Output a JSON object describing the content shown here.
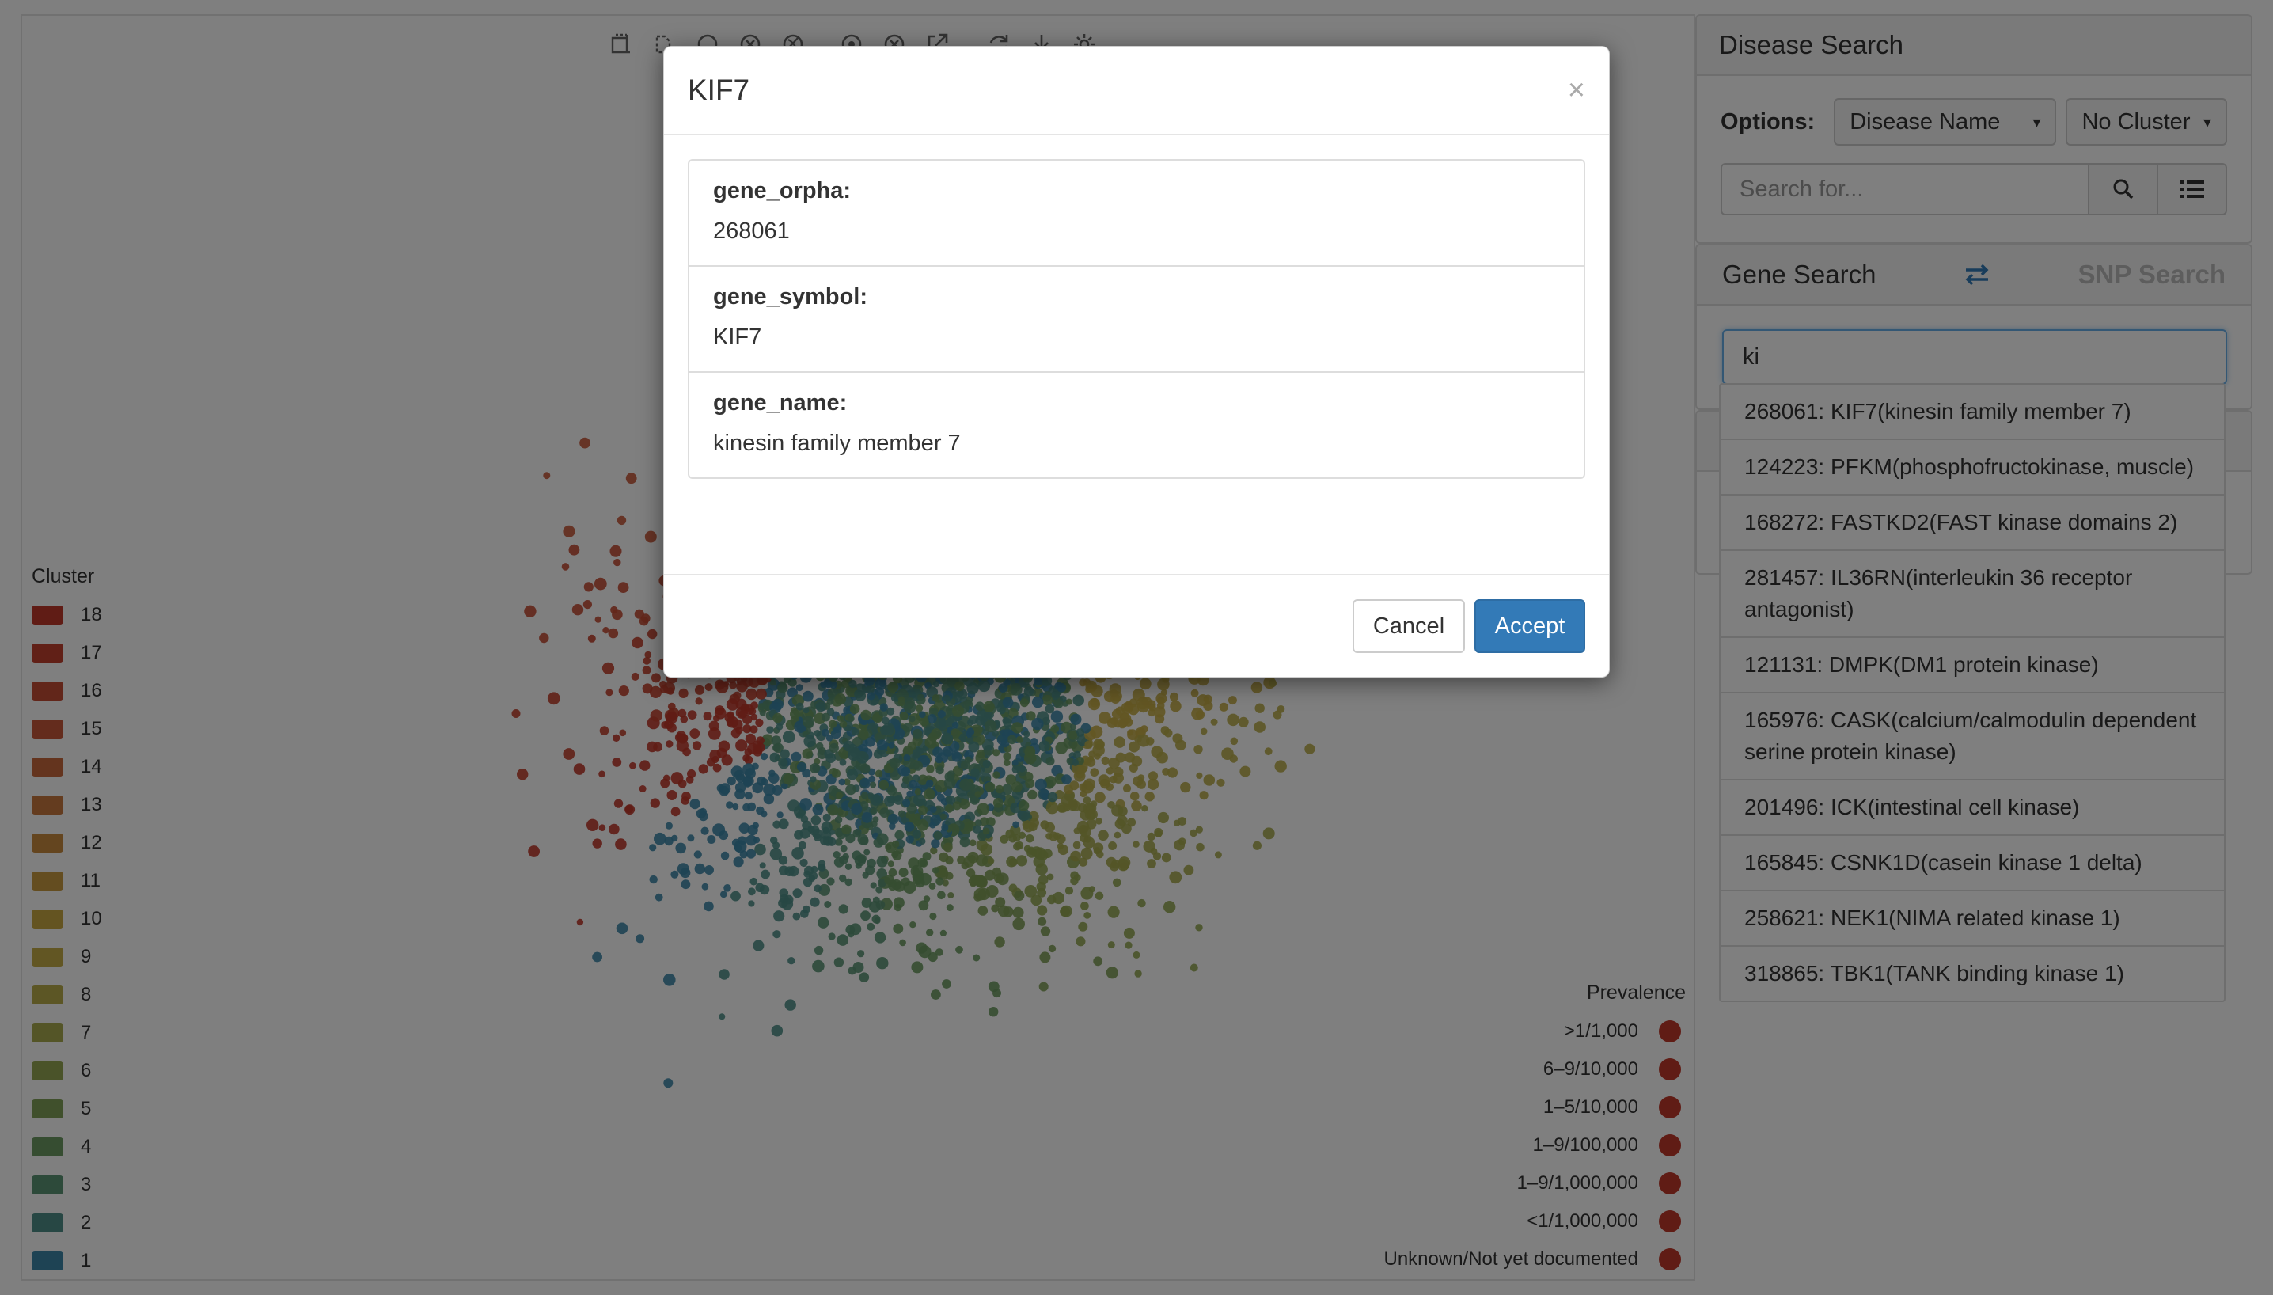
{
  "toolbar": {
    "icons": [
      "box-select-icon",
      "lasso-select-icon",
      "circle-select-icon",
      "clear-select-icon",
      "globe-icon",
      "target-icon",
      "close-circle-icon",
      "external-link-icon",
      "refresh-icon",
      "download-icon",
      "settings-icon"
    ]
  },
  "cluster_legend": {
    "title": "Cluster",
    "items": [
      {
        "label": "18",
        "color": "#c0392b"
      },
      {
        "label": "17",
        "color": "#c2412f"
      },
      {
        "label": "16",
        "color": "#c54c35"
      },
      {
        "label": "15",
        "color": "#c8583a"
      },
      {
        "label": "14",
        "color": "#c9693c"
      },
      {
        "label": "13",
        "color": "#c9793e"
      },
      {
        "label": "12",
        "color": "#c98a3f"
      },
      {
        "label": "11",
        "color": "#c99a41"
      },
      {
        "label": "10",
        "color": "#c9a843"
      },
      {
        "label": "9",
        "color": "#c5ad47"
      },
      {
        "label": "8",
        "color": "#b9ad4a"
      },
      {
        "label": "7",
        "color": "#a9ab4f"
      },
      {
        "label": "6",
        "color": "#95a753"
      },
      {
        "label": "5",
        "color": "#81a058"
      },
      {
        "label": "4",
        "color": "#6c9a62"
      },
      {
        "label": "3",
        "color": "#5b9474"
      },
      {
        "label": "2",
        "color": "#4f8f88"
      },
      {
        "label": "1",
        "color": "#3d87a8"
      }
    ]
  },
  "prevalence_legend": {
    "title": "Prevalence",
    "color": "#c0392b",
    "items": [
      ">1/1,000",
      "6–9/10,000",
      "1–5/10,000",
      "1–9/100,000",
      "1–9/1,000,000",
      "<1/1,000,000",
      "Unknown/Not yet documented"
    ]
  },
  "disease_search": {
    "title": "Disease Search",
    "options_label": "Options:",
    "select_type": "Disease Name",
    "select_cluster": "No Cluster",
    "search_placeholder": "Search for...",
    "search_button_icon": "search-icon",
    "list_button_icon": "list-icon"
  },
  "gene_search": {
    "gene_tab": "Gene Search",
    "snp_tab": "SNP Search",
    "swap_icon": "swap-icon",
    "input_value": "ki",
    "suggestions": [
      "268061: KIF7(kinesin family member 7)",
      "124223: PFKM(phosphofructokinase, muscle)",
      "168272: FASTKD2(FAST kinase domains 2)",
      "281457: IL36RN(interleukin 36 receptor antagonist)",
      "121131: DMPK(DM1 protein kinase)",
      "165976: CASK(calcium/calmodulin dependent serine protein kinase)",
      "201496: ICK(intestinal cell kinase)",
      "165845: CSNK1D(casein kinase 1 delta)",
      "258621: NEK1(NIMA related kinase 1)",
      "318865: TBK1(TANK binding kinase 1)"
    ]
  },
  "modal": {
    "title": "KIF7",
    "close": "×",
    "fields": [
      {
        "key": "gene_orpha:",
        "value": "268061"
      },
      {
        "key": "gene_symbol:",
        "value": "KIF7"
      },
      {
        "key": "gene_name:",
        "value": "kinesin family member 7"
      }
    ],
    "cancel_label": "Cancel",
    "accept_label": "Accept"
  }
}
